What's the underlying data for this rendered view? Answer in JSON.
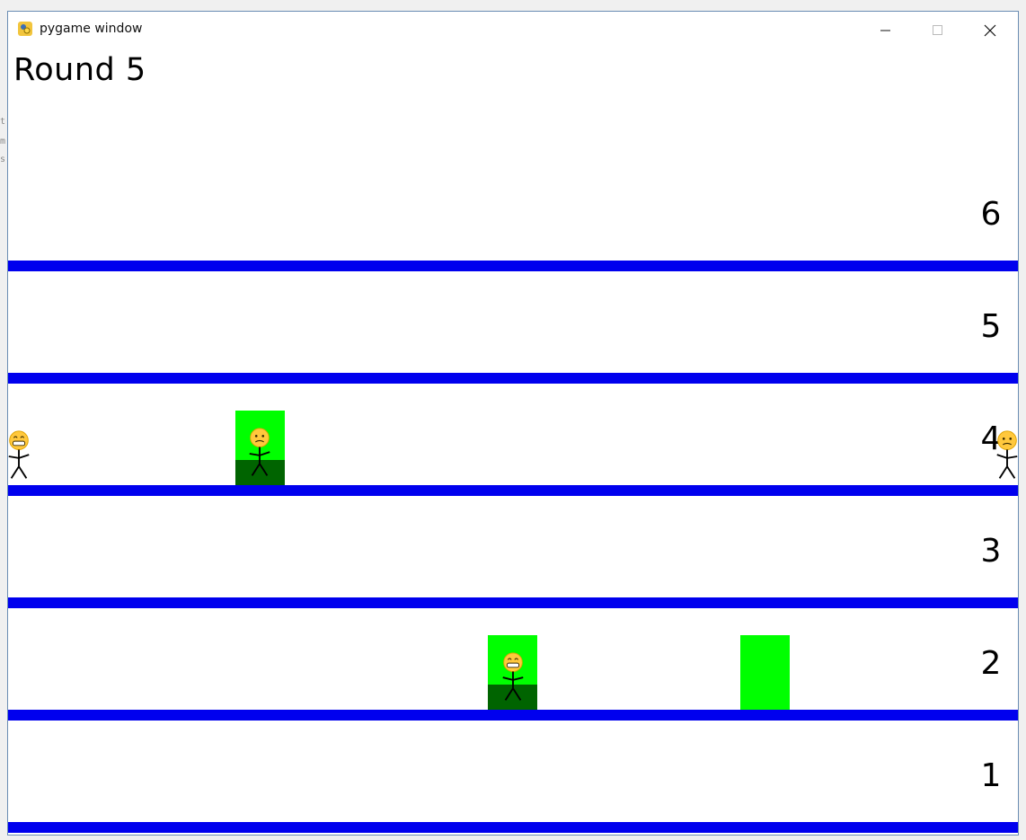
{
  "window": {
    "title": "pygame window",
    "app_icon": "pygame-snake-icon",
    "controls": [
      "minimize-icon",
      "maximize-icon",
      "close-icon"
    ]
  },
  "game": {
    "round_label": "Round 5",
    "floors": [
      {
        "number": "6"
      },
      {
        "number": "5"
      },
      {
        "number": "4"
      },
      {
        "number": "3"
      },
      {
        "number": "2"
      },
      {
        "number": "1"
      }
    ],
    "colors": {
      "floor_line": "#0000ee",
      "elevator": "#00ff00",
      "elevator_dark": "#006400",
      "background": "#ffffff"
    },
    "elevators": [
      {
        "floor": 4,
        "occupied": true,
        "passenger_mood": "worried"
      },
      {
        "floor": 2,
        "occupied": true,
        "passenger_mood": "grinning"
      },
      {
        "floor": 2,
        "occupied": false
      }
    ],
    "waiting_people": [
      {
        "floor": 4,
        "side": "left",
        "mood": "grinning"
      },
      {
        "floor": 4,
        "side": "right",
        "mood": "worried"
      }
    ]
  }
}
